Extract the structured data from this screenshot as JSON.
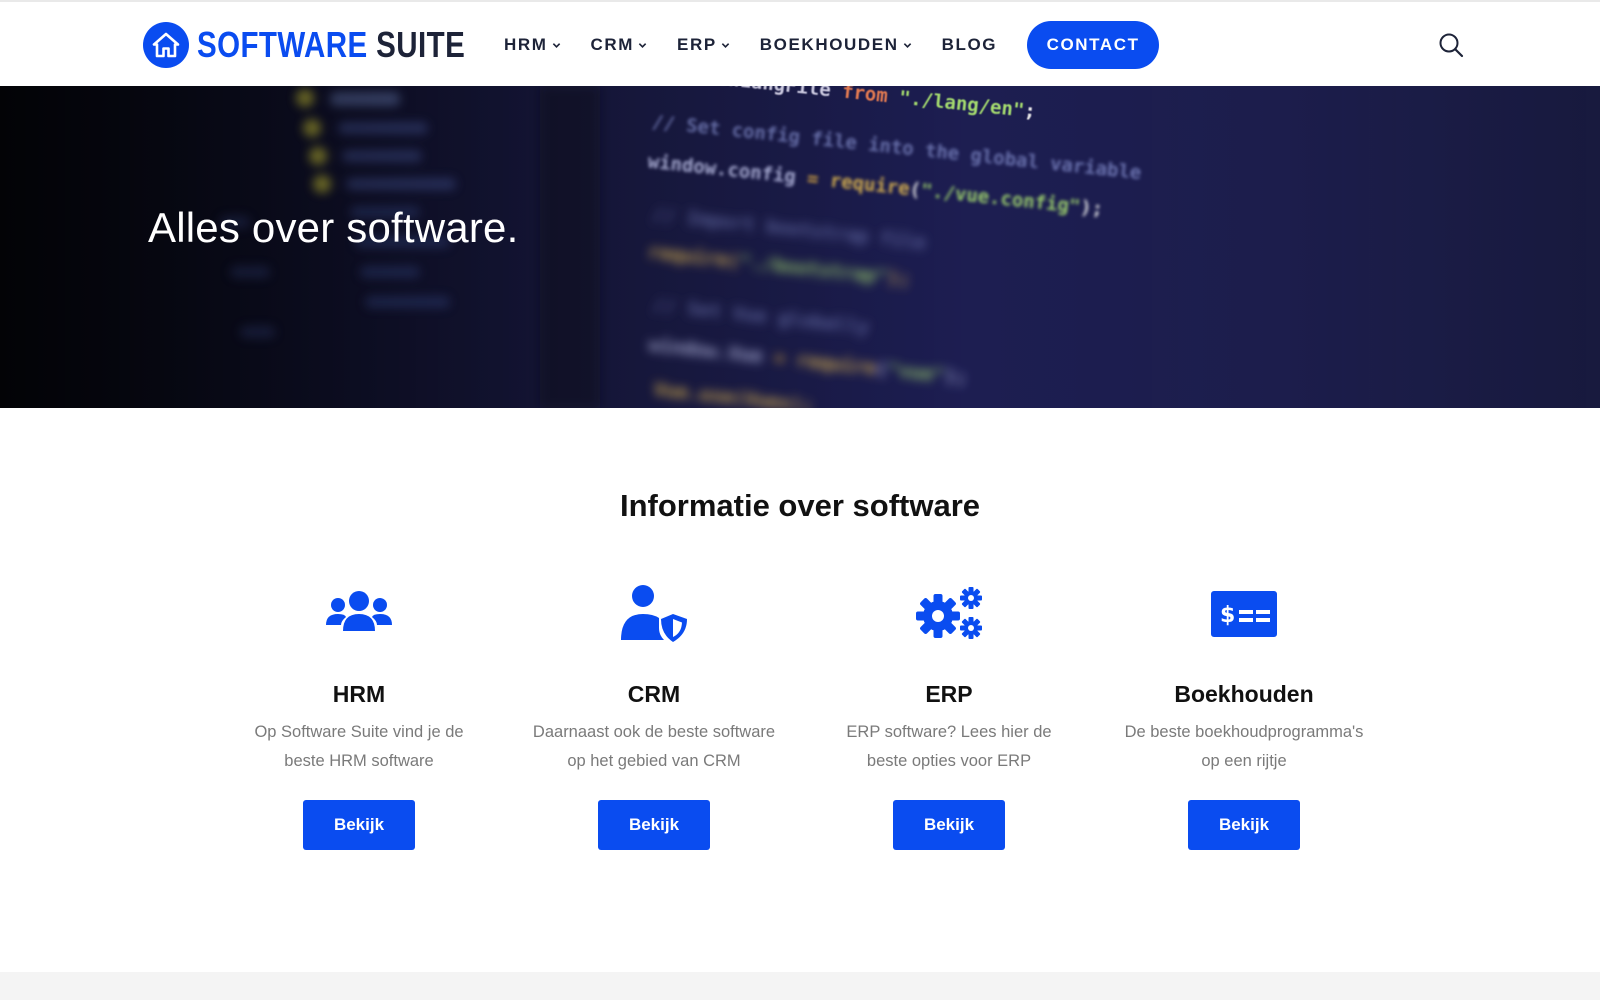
{
  "header": {
    "logo_word_1": "SOFTWARE",
    "logo_word_2": "SUITE",
    "logo_icon": "home-icon",
    "nav": [
      {
        "label": "HRM",
        "dropdown": true
      },
      {
        "label": "CRM",
        "dropdown": true
      },
      {
        "label": "ERP",
        "dropdown": true
      },
      {
        "label": "BOEKHOUDEN",
        "dropdown": true
      },
      {
        "label": "BLOG",
        "dropdown": false
      }
    ],
    "contact_label": "CONTACT",
    "search_icon": "search-icon"
  },
  "hero": {
    "title": "Alles over software.",
    "code_lines": [
      "import enLangFile from \"./lang/en\";",
      "// Set config file into the global variable",
      "window.config = require(\"./vue.config\");",
      "// Import bootstrap file",
      "require(\"./bootstrap\");",
      "// Set Vue globally",
      "window.Vue = require(\"vue\");"
    ]
  },
  "main": {
    "section_title": "Informatie over software",
    "cards": [
      {
        "icon": "users-icon",
        "title": "HRM",
        "desc_1": "Op Software Suite vind je de",
        "desc_2": "beste HRM software",
        "button": "Bekijk"
      },
      {
        "icon": "user-shield-icon",
        "title": "CRM",
        "desc_1": "Daarnaast ook de beste software",
        "desc_2": "op het gebied van CRM",
        "button": "Bekijk"
      },
      {
        "icon": "cogs-icon",
        "title": "ERP",
        "desc_1": "ERP software? Lees hier de",
        "desc_2": "beste opties voor ERP",
        "button": "Bekijk"
      },
      {
        "icon": "money-check-icon",
        "title": "Boekhouden",
        "desc_1": "De beste boekhoudprogramma's",
        "desc_2": "op een rijtje",
        "button": "Bekijk"
      }
    ]
  },
  "colors": {
    "accent": "#0a4cf0",
    "dark": "#1d2338",
    "muted_text": "#7a7a7a"
  }
}
